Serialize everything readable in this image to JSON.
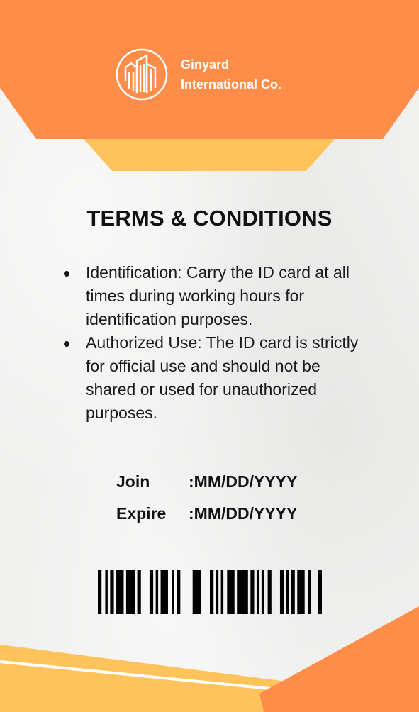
{
  "company": {
    "line1": "Ginyard",
    "line2": "International Co."
  },
  "logo": {
    "icon": "buildings-logo-icon"
  },
  "terms": {
    "title": "TERMS & CONDITIONS",
    "items": [
      "Identification: Carry the ID card at all times during working hours for identification purposes.",
      "Authorized Use: The ID card is strictly for official use and should not be shared or used for unauthorized purposes."
    ]
  },
  "dates": {
    "join_label": "Join",
    "join_value": ":MM/DD/YYYY",
    "expire_label": "Expire",
    "expire_value": ":MM/DD/YYYY"
  },
  "barcode": {
    "icon": "barcode-icon"
  },
  "colors": {
    "orange": "#ff8d4a",
    "light_orange": "#ffc35c",
    "background": "#f1f1f0",
    "text": "#111111"
  }
}
